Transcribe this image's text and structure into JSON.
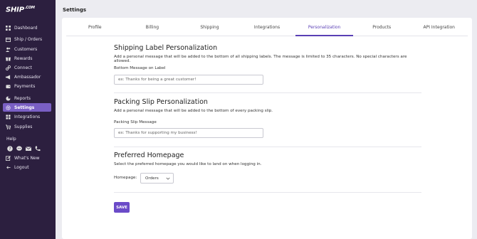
{
  "brand": {
    "logo_text": "SHIP",
    "logo_small": ".COM"
  },
  "sidebar": {
    "items": [
      {
        "label": "Dashboard",
        "icon": "grid-icon"
      },
      {
        "label": "Ship / Orders",
        "icon": "box-icon"
      },
      {
        "label": "Customers",
        "icon": "users-icon"
      },
      {
        "label": "Rewards",
        "icon": "gift-icon"
      },
      {
        "label": "Connect",
        "icon": "link-icon"
      },
      {
        "label": "Ambassador",
        "icon": "megaphone-icon"
      },
      {
        "label": "Payments",
        "icon": "wallet-icon"
      },
      {
        "label": "Reports",
        "icon": "chart-icon"
      },
      {
        "label": "Settings",
        "icon": "gear-icon"
      },
      {
        "label": "Integrations",
        "icon": "puzzle-icon"
      },
      {
        "label": "Supplies",
        "icon": "cart-icon"
      }
    ],
    "help_label": "Help",
    "help_icons": [
      "question-icon",
      "chat-icon",
      "mail-icon",
      "phone-icon"
    ],
    "whats_new": "What's New",
    "logout": "Logout"
  },
  "page": {
    "title": "Settings"
  },
  "tabs": [
    "Profile",
    "Billing",
    "Shipping",
    "Integrations",
    "Personalization",
    "Products",
    "API Integration"
  ],
  "active_tab": "Personalization",
  "shipping_label": {
    "heading": "Shipping Label Personalization",
    "description": "Add a personal message that will be added to the bottom of all shipping labels. The message is limited to 35 characters. No special characters are allowed.",
    "field_label": "Bottom Message on Label",
    "placeholder": "ex: Thanks for being a great customer!",
    "value": ""
  },
  "packing_slip": {
    "heading": "Packing Slip Personalization",
    "description": "Add a personal message that will be added to the bottom of every packing slip.",
    "field_label": "Packing Slip Message",
    "placeholder": "ex: Thanks for supporting my business!",
    "value": ""
  },
  "homepage": {
    "heading": "Preferred Homepage",
    "description": "Select the preferred homepage you would like to land on when logging in.",
    "field_label": "Homepage:",
    "selected": "Orders"
  },
  "save_label": "SAVE",
  "colors": {
    "sidebar_bg": "#2c1f3f",
    "accent": "#6b4bc8",
    "active_nav": "#7a5fc4"
  }
}
